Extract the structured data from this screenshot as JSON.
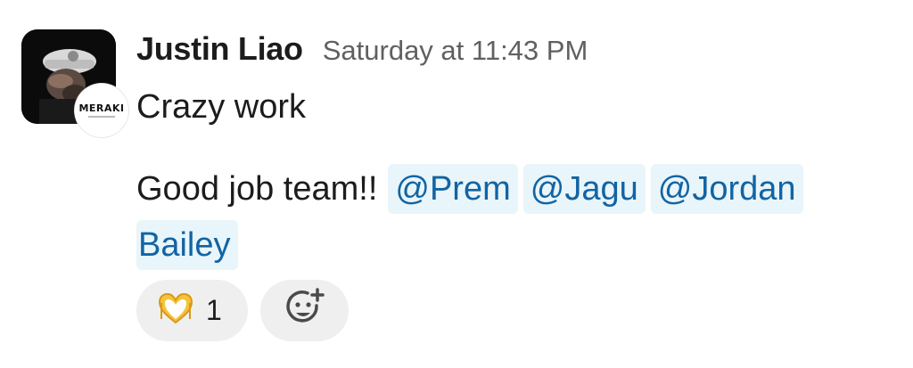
{
  "message": {
    "author": "Justin Liao",
    "timestamp": "Saturday at 11:43 PM",
    "avatar_badge_text": "MERAKI",
    "line1": "Crazy work",
    "line2_text": "Good job team!!",
    "mentions": [
      "@Prem",
      "@Jagu",
      "@Jordan",
      "Bailey"
    ]
  },
  "reactions": [
    {
      "emoji": "heart-hands-icon",
      "count": "1"
    },
    {
      "emoji": "add-reaction-icon",
      "count": ""
    }
  ],
  "colors": {
    "mention_bg": "#e8f5fa",
    "mention_text": "#1264a3",
    "reaction_bg": "#efefef",
    "timestamp": "#616061",
    "text": "#1d1c1d"
  }
}
